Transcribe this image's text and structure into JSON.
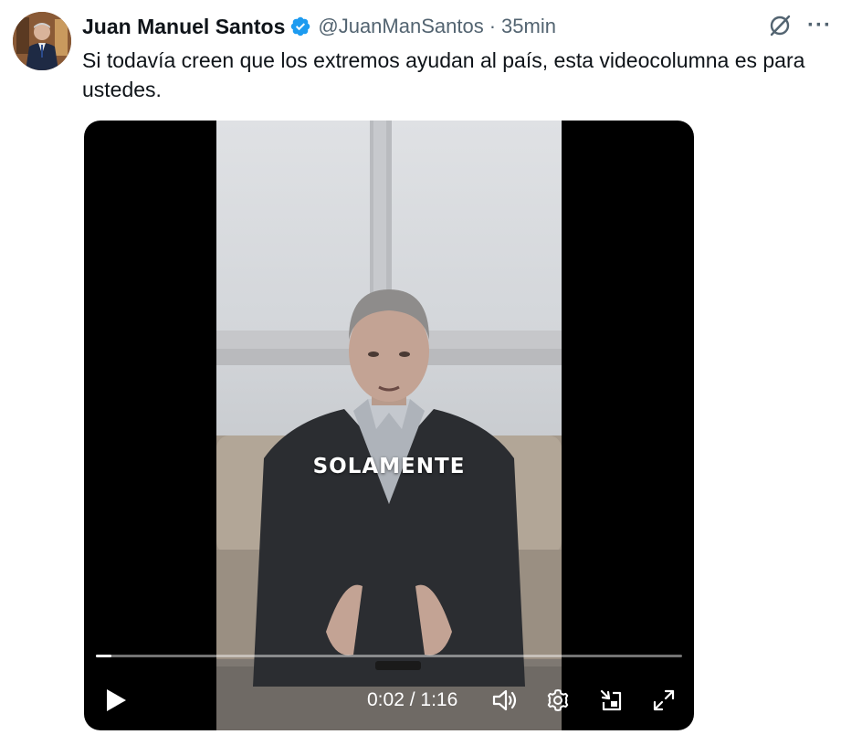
{
  "tweet": {
    "author_name": "Juan Manuel Santos",
    "handle": "@JuanManSantos",
    "separator": "·",
    "time": "35min",
    "text": "Si todavía creen que los extremos ayudan al país, esta videocolumna es para ustedes."
  },
  "video": {
    "caption": "SOLAMENTE",
    "current_time": "0:02",
    "duration": "1:16",
    "time_separator": " / ",
    "progress_fraction": 0.026
  },
  "icons": {
    "verified": "verified-badge-icon",
    "grok": "grok-icon",
    "more": "more-icon",
    "play": "play-icon",
    "volume": "volume-icon",
    "settings": "gear-icon",
    "pip": "picture-in-picture-icon",
    "fullscreen": "fullscreen-icon"
  },
  "colors": {
    "verified_blue": "#1d9bf0",
    "secondary_text": "#536471",
    "primary_text": "#0f1419"
  }
}
